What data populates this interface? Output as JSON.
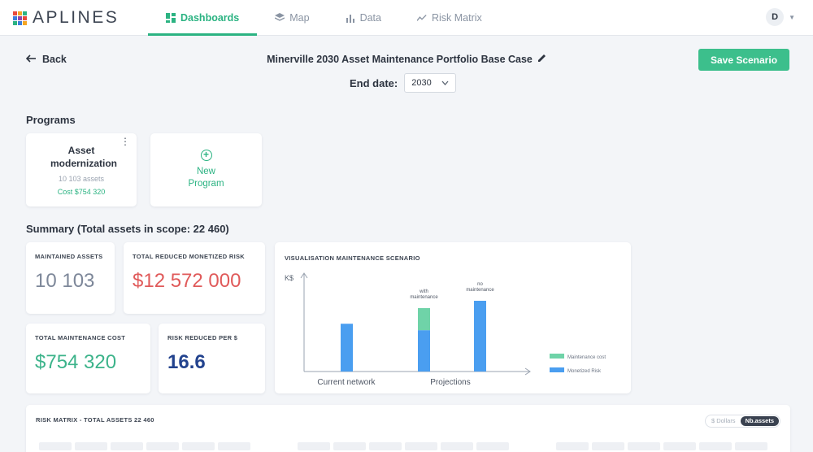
{
  "app": {
    "logo_text": "APLINES",
    "logo_colors": [
      "#e84a3c",
      "#f5a623",
      "#2bb382",
      "#3d7ddb",
      "#8e44ad",
      "#e84a3c",
      "#2bb382",
      "#3d7ddb",
      "#f5a623"
    ]
  },
  "nav": {
    "tabs": [
      {
        "label": "Dashboards",
        "icon": "dashboard-icon",
        "active": true
      },
      {
        "label": "Map",
        "icon": "layers-icon",
        "active": false
      },
      {
        "label": "Data",
        "icon": "bar-chart-icon",
        "active": false
      },
      {
        "label": "Risk Matrix",
        "icon": "line-chart-icon",
        "active": false
      }
    ],
    "user_initial": "D"
  },
  "scenario": {
    "back_label": "Back",
    "title": "Minerville 2030 Asset Maintenance Portfolio Base Case",
    "end_date_label": "End date:",
    "end_date_value": "2030",
    "save_label": "Save Scenario"
  },
  "programs": {
    "title": "Programs",
    "items": [
      {
        "name": "Asset modernization",
        "assets": "10 103 assets",
        "cost": "Cost $754 320"
      }
    ],
    "new_label": "New Program"
  },
  "summary": {
    "title": "Summary  (Total assets in scope: 22 460)",
    "kpis": {
      "maintained": {
        "label": "MAINTAINED ASSETS",
        "value": "10 103",
        "color": "#7d8799"
      },
      "reduced_risk": {
        "label": "TOTAL REDUCED MONETIZED RISK",
        "value": "$12 572 000",
        "color": "#e05a5a"
      },
      "cost": {
        "label": "TOTAL MAINTENANCE COST",
        "value": "$754 320",
        "color": "#3cb38a"
      },
      "risk_per_dollar": {
        "label": "RISK REDUCED PER $",
        "value": "16.6",
        "color": "#23438e"
      }
    },
    "visualisation_title": "VISUALISATION MAINTENANCE SCENARIO"
  },
  "chart_data": {
    "type": "bar",
    "ylabel": "K$",
    "categories": [
      "Current network",
      "Projections"
    ],
    "bars": [
      {
        "group": "Current network",
        "label": "",
        "risk": 0.52,
        "cost": 0
      },
      {
        "group": "Projections",
        "label": "with maintenance",
        "risk": 0.45,
        "cost": 0.24
      },
      {
        "group": "Projections",
        "label": "no maintenance",
        "risk": 0.77,
        "cost": 0
      }
    ],
    "legend": [
      {
        "name": "Maintenance cost",
        "color": "#6fd3a8"
      },
      {
        "name": "Monetized Risk",
        "color": "#4a9ef0"
      }
    ],
    "legend_position": "bottom-right",
    "grid": false
  },
  "risk_matrix": {
    "label": "RISK MATRIX - TOTAL ASSETS 22 460",
    "toggle": [
      {
        "label": "$ Dollars",
        "active": false
      },
      {
        "label": "Nb.assets",
        "active": true
      }
    ]
  }
}
